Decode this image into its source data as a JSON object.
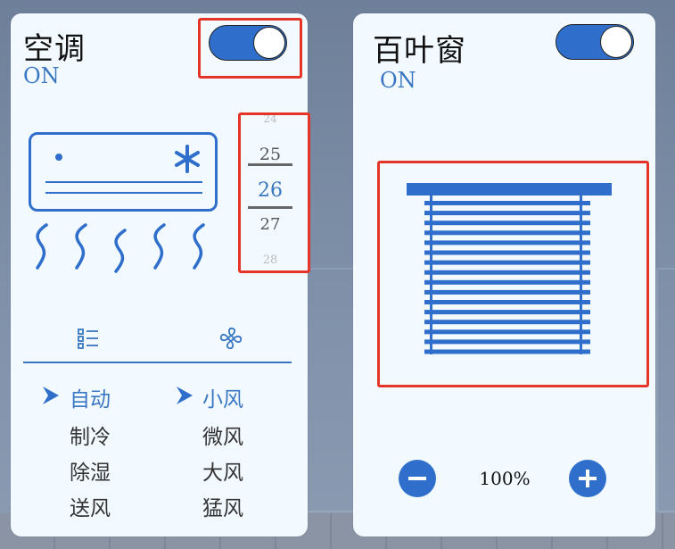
{
  "ac": {
    "title": "空调",
    "state": "ON",
    "toggle_on": true,
    "temperatures": {
      "far_above": "24",
      "above": "25",
      "selected": "26",
      "below": "27",
      "far_below": "28"
    },
    "tabs": [
      {
        "icon": "mode-list-icon"
      },
      {
        "icon": "fan-icon"
      }
    ],
    "modes": {
      "items": [
        "自动",
        "制冷",
        "除湿",
        "送风"
      ],
      "selected": "自动"
    },
    "fan_speeds": {
      "items": [
        "小风",
        "微风",
        "大风",
        "猛风"
      ],
      "selected": "小风"
    }
  },
  "blind": {
    "title": "百叶窗",
    "state": "ON",
    "toggle_on": true,
    "open_value": "100%"
  },
  "colors": {
    "accent": "#2f6fcb",
    "highlight_box": "#e53528",
    "card_bg": "#f2f9ff"
  }
}
